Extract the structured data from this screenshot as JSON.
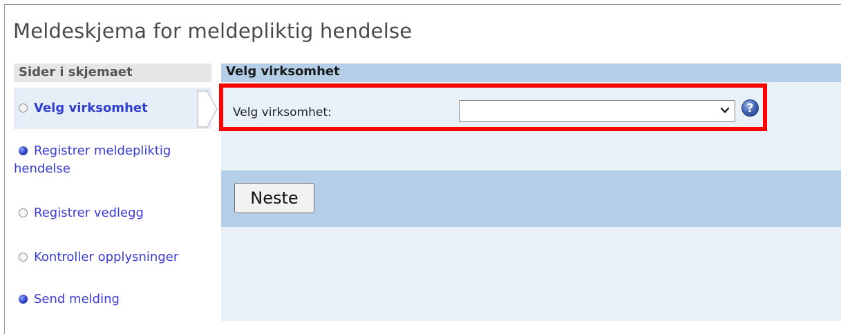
{
  "page": {
    "title": "Meldeskjema for meldepliktig hendelse"
  },
  "sidebar": {
    "header": "Sider i skjemaet",
    "items": [
      {
        "label": "Velg virksomhet",
        "bullet": "empty-circle-icon",
        "active": true
      },
      {
        "label": "Registrer meldepliktig hendelse",
        "bullet": "filled-circle-icon",
        "active": false
      },
      {
        "label": "Registrer vedlegg",
        "bullet": "empty-circle-icon",
        "active": false
      },
      {
        "label": "Kontroller opplysninger",
        "bullet": "empty-circle-icon",
        "active": false
      },
      {
        "label": "Send melding",
        "bullet": "filled-circle-icon",
        "active": false
      }
    ]
  },
  "main": {
    "header": "Velg virksomhet",
    "field": {
      "label": "Velg virksomhet:",
      "value": ""
    },
    "help_icon": "?",
    "next_button": "Neste"
  },
  "colors": {
    "header_bg": "#b5cfe9",
    "panel_bg": "#e8f0f8",
    "link": "#3b3bd6",
    "highlight": "#ff0000"
  }
}
